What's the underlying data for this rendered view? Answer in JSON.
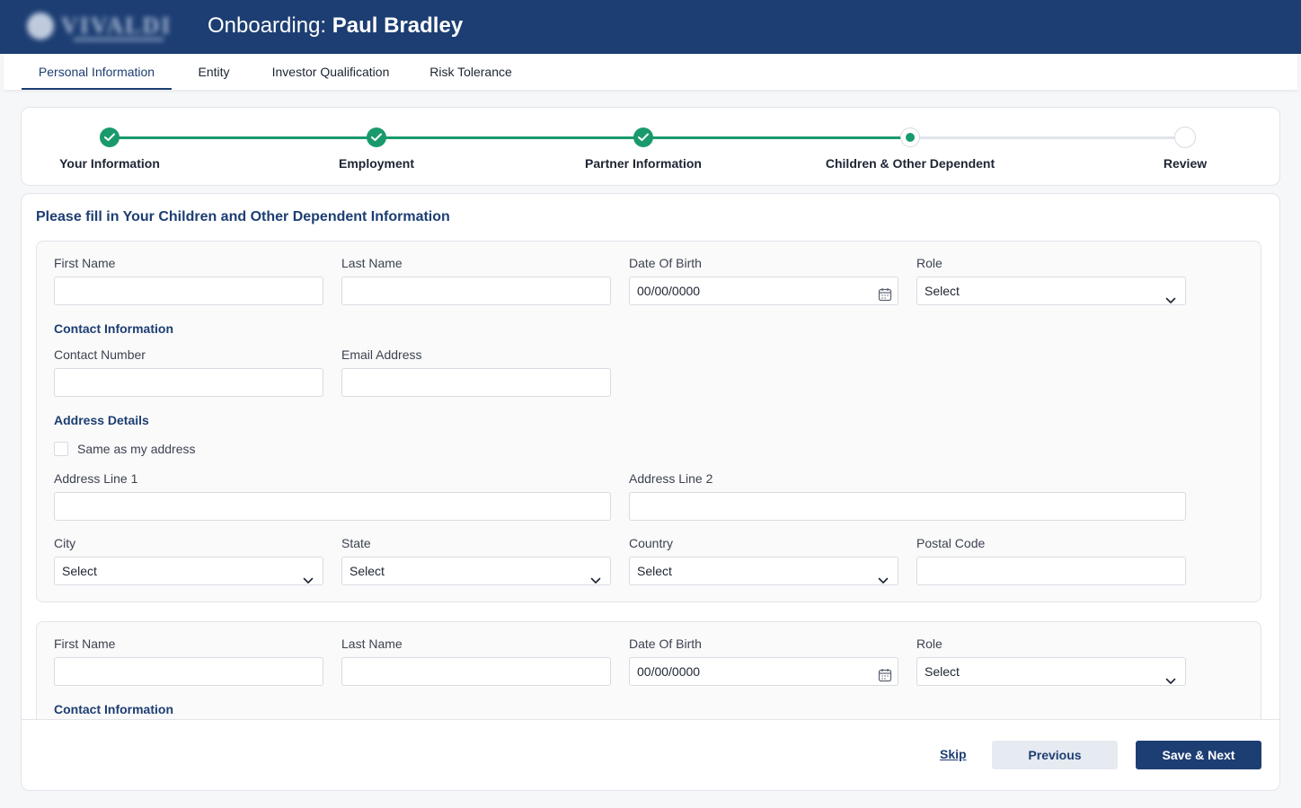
{
  "header": {
    "title_prefix": "Onboarding:",
    "title_name": "Paul Bradley"
  },
  "tabs": [
    {
      "label": "Personal Information",
      "active": true
    },
    {
      "label": "Entity",
      "active": false
    },
    {
      "label": "Investor Qualification",
      "active": false
    },
    {
      "label": "Risk Tolerance",
      "active": false
    }
  ],
  "stepper": {
    "steps": [
      {
        "label": "Your Information",
        "status": "done"
      },
      {
        "label": "Employment",
        "status": "done"
      },
      {
        "label": "Partner Information",
        "status": "done"
      },
      {
        "label": "Children & Other Dependent",
        "status": "current"
      },
      {
        "label": "Review",
        "status": "pending"
      }
    ],
    "done_color": "#1a9a6c",
    "pending_color": "#e1e4ea"
  },
  "form": {
    "heading": "Please fill in Your Children and Other Dependent Information",
    "dependent_1": {
      "first_name_label": "First Name",
      "first_name_value": "",
      "last_name_label": "Last Name",
      "last_name_value": "",
      "dob_label": "Date Of Birth",
      "dob_value": "00/00/0000",
      "role_label": "Role",
      "role_value": "Select",
      "contact_section": "Contact Information",
      "contact_number_label": "Contact Number",
      "contact_number_value": "",
      "email_label": "Email Address",
      "email_value": "",
      "address_section": "Address Details",
      "same_address_label": "Same as my address",
      "same_address_checked": false,
      "address1_label": "Address Line 1",
      "address1_value": "",
      "address2_label": "Address Line 2",
      "address2_value": "",
      "city_label": "City",
      "city_value": "Select",
      "state_label": "State",
      "state_value": "Select",
      "country_label": "Country",
      "country_value": "Select",
      "postal_label": "Postal Code",
      "postal_value": ""
    },
    "dependent_2": {
      "first_name_label": "First Name",
      "first_name_value": "",
      "last_name_label": "Last Name",
      "last_name_value": "",
      "dob_label": "Date Of Birth",
      "dob_value": "00/00/0000",
      "role_label": "Role",
      "role_value": "Select",
      "contact_section": "Contact Information"
    }
  },
  "footer": {
    "skip_label": "Skip",
    "previous_label": "Previous",
    "next_label": "Save & Next"
  },
  "colors": {
    "brand": "#1d3e73",
    "success": "#1a9a6c"
  }
}
